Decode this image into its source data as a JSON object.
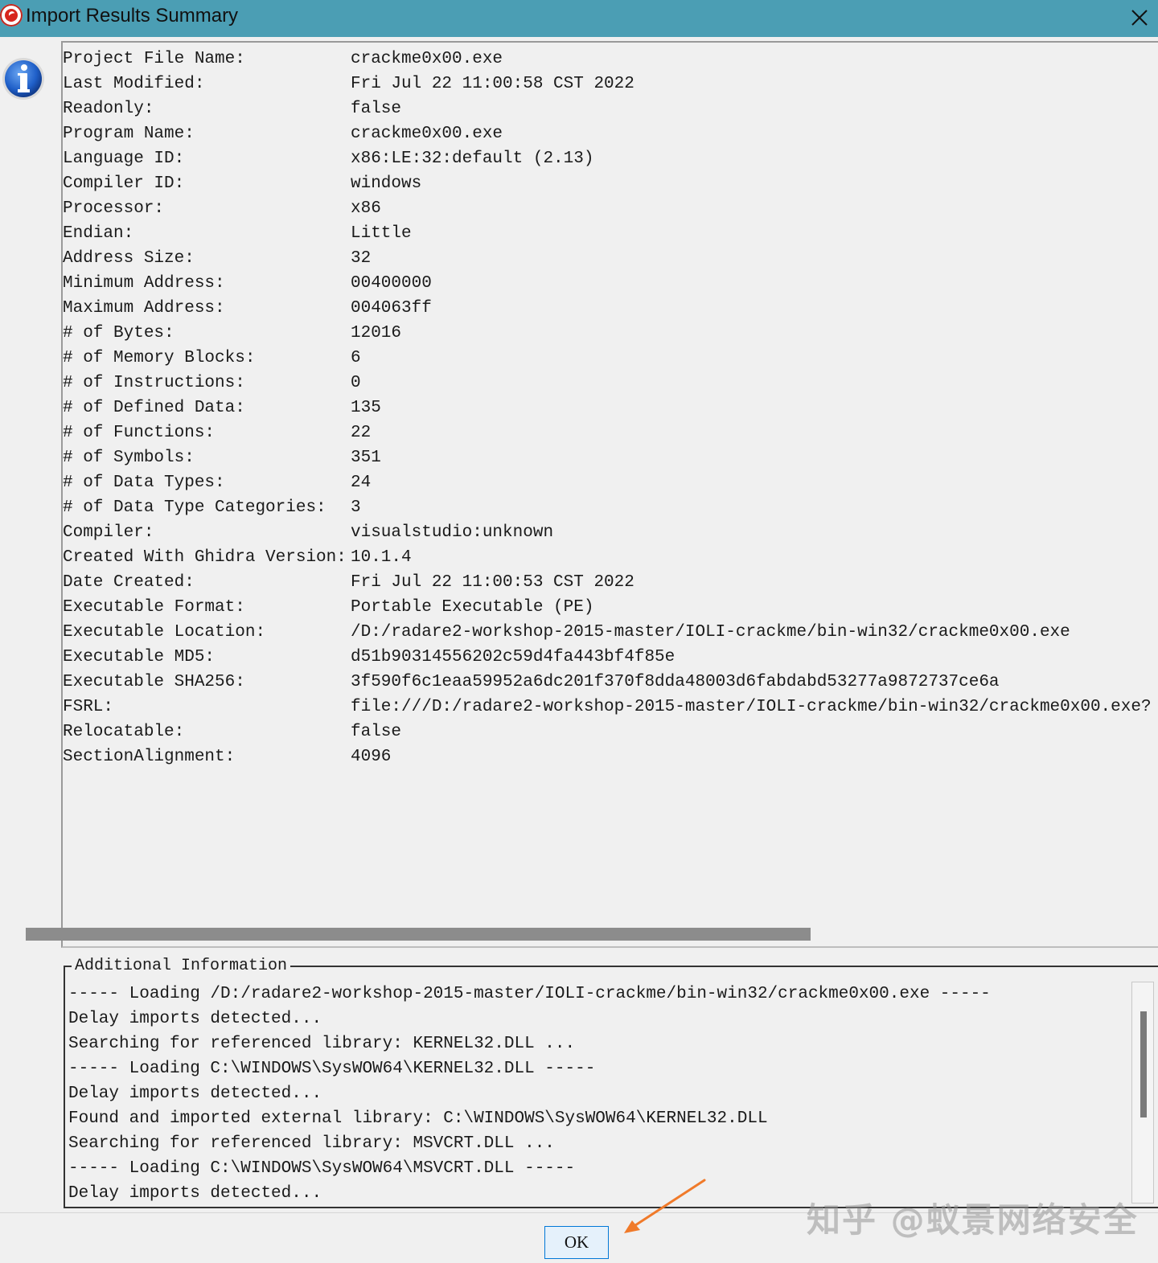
{
  "window": {
    "title": "Import Results Summary",
    "title_bar_color": "#4b9eb4",
    "close_icon": "close-icon",
    "app_icon": "ghidra-dragon-icon"
  },
  "info_icon": "info-icon",
  "summary": {
    "rows": [
      {
        "key": "Project File Name:",
        "value": "crackme0x00.exe"
      },
      {
        "key": "Last Modified:",
        "value": "Fri Jul 22 11:00:58 CST 2022"
      },
      {
        "key": "Readonly:",
        "value": "false"
      },
      {
        "key": "Program Name:",
        "value": "crackme0x00.exe"
      },
      {
        "key": "Language ID:",
        "value": "x86:LE:32:default (2.13)"
      },
      {
        "key": "Compiler ID:",
        "value": "windows"
      },
      {
        "key": "Processor:",
        "value": "x86"
      },
      {
        "key": "Endian:",
        "value": "Little"
      },
      {
        "key": "Address Size:",
        "value": "32"
      },
      {
        "key": "Minimum Address:",
        "value": "00400000"
      },
      {
        "key": "Maximum Address:",
        "value": "004063ff"
      },
      {
        "key": "# of Bytes:",
        "value": "12016"
      },
      {
        "key": "# of Memory Blocks:",
        "value": "6"
      },
      {
        "key": "# of Instructions:",
        "value": "0"
      },
      {
        "key": "# of Defined Data:",
        "value": "135"
      },
      {
        "key": "# of Functions:",
        "value": "22"
      },
      {
        "key": "# of Symbols:",
        "value": "351"
      },
      {
        "key": "# of Data Types:",
        "value": "24"
      },
      {
        "key": "# of Data Type Categories:",
        "value": "3"
      },
      {
        "key": "Compiler:",
        "value": "visualstudio:unknown"
      },
      {
        "key": "Created With Ghidra Version:",
        "value": "10.1.4"
      },
      {
        "key": "Date Created:",
        "value": "Fri Jul 22 11:00:53 CST 2022"
      },
      {
        "key": "Executable Format:",
        "value": "Portable Executable (PE)"
      },
      {
        "key": "Executable Location:",
        "value": "/D:/radare2-workshop-2015-master/IOLI-crackme/bin-win32/crackme0x00.exe"
      },
      {
        "key": "Executable MD5:",
        "value": "d51b90314556202c59d4fa443bf4f85e"
      },
      {
        "key": "Executable SHA256:",
        "value": "3f590f6c1eaa59952a6dc201f370f8dda48003d6fabdabd53277a9872737ce6a"
      },
      {
        "key": "FSRL:",
        "value": "file:///D:/radare2-workshop-2015-master/IOLI-crackme/bin-win32/crackme0x00.exe?"
      },
      {
        "key": "Relocatable:",
        "value": "false"
      },
      {
        "key": "SectionAlignment:",
        "value": "4096"
      }
    ]
  },
  "additional_info": {
    "legend": "Additional Information",
    "lines": [
      "----- Loading /D:/radare2-workshop-2015-master/IOLI-crackme/bin-win32/crackme0x00.exe -----",
      "Delay imports detected...",
      "Searching for referenced library: KERNEL32.DLL ...",
      "----- Loading C:\\WINDOWS\\SysWOW64\\KERNEL32.DLL -----",
      "Delay imports detected...",
      "Found and imported external library: C:\\WINDOWS\\SysWOW64\\KERNEL32.DLL",
      "Searching for referenced library: MSVCRT.DLL ...",
      "----- Loading C:\\WINDOWS\\SysWOW64\\MSVCRT.DLL -----",
      "Delay imports detected..."
    ]
  },
  "footer": {
    "ok_label": "OK",
    "arrow_color": "#f07a2a"
  },
  "watermark": "知乎 @蚁景网络安全"
}
